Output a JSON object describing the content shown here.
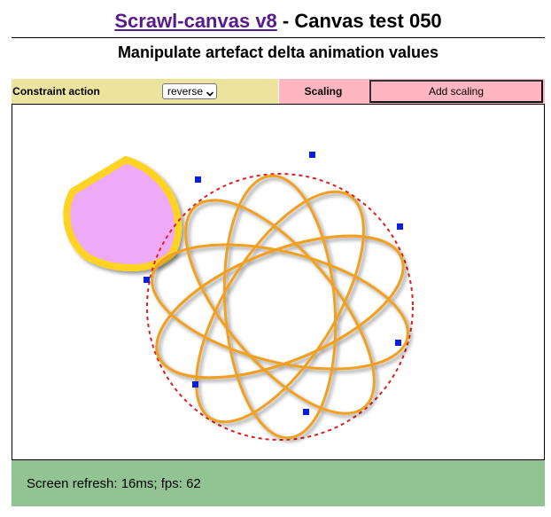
{
  "header": {
    "app_link": "Scrawl-canvas v8",
    "title_suffix": " - Canvas test 050",
    "subtitle": "Manipulate artefact delta animation values"
  },
  "controls": {
    "constraint_label": "Constraint action",
    "constraint_value": "reverse",
    "scaling_label": "Scaling",
    "add_scaling_button": "Add scaling"
  },
  "status": {
    "screen_refresh_text": "Screen refresh: 16ms; fps: 62"
  },
  "colors": {
    "control_yellow": "#ebe39e",
    "control_pink": "#ffb6c1",
    "status_green": "#92c393",
    "link_purple": "#551a8b",
    "blob_fill": "#eeaaf8",
    "blob_stroke": "#ffd320",
    "curve_stroke": "#f0a020",
    "dashed_circle": "#e02020",
    "pin_blue": "#0a1ee0"
  },
  "icons": {
    "select_chevron": "chevron-down-icon"
  }
}
